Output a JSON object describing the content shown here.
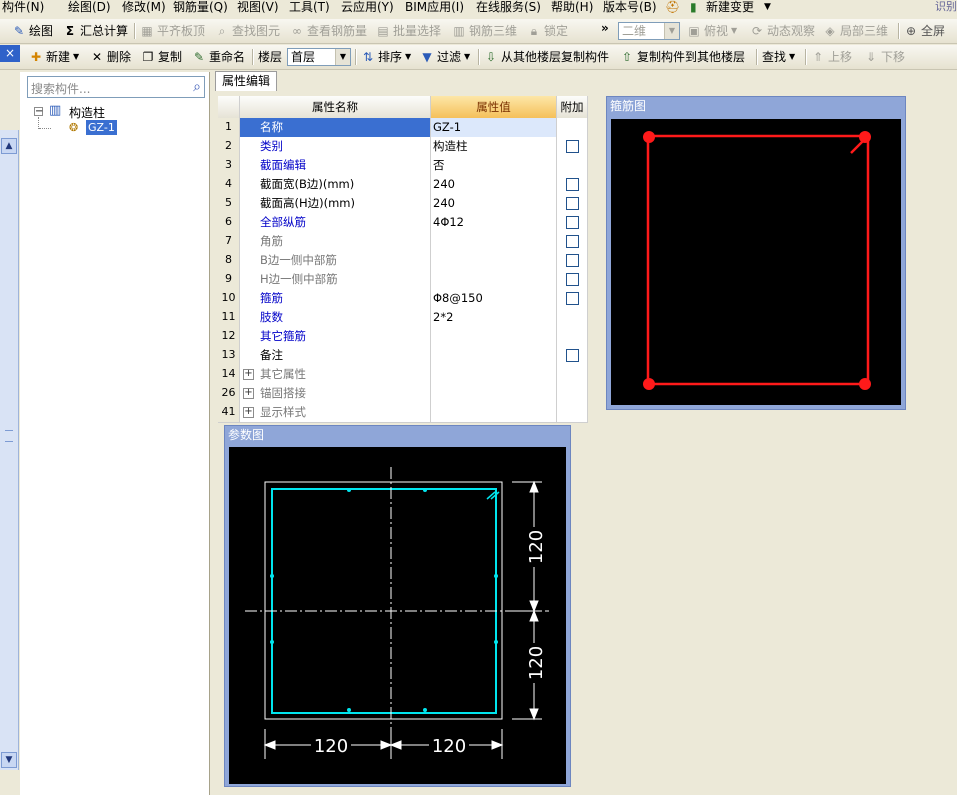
{
  "menu": [
    "构件(N)",
    "绘图(D)",
    "修改(M)",
    "钢筋量(Q)",
    "视图(V)",
    "工具(T)",
    "云应用(Y)",
    "BIM应用(I)",
    "在线服务(S)",
    "帮助(H)",
    "版本号(B)",
    "新建变更"
  ],
  "menu_overflow": "识别",
  "toolbar1": {
    "draw": "绘图",
    "sum": "汇总计算",
    "level": "平齐板顶",
    "find_elem": "查找图元",
    "view_rebar": "查看钢筋量",
    "batch_select": "批量选择",
    "rebar_3d": "钢筋三维",
    "lock": "锁定",
    "view_mode": "二维",
    "top_view": "俯视",
    "dynamic_view": "动态观察",
    "local_3d": "局部三维",
    "fullscreen": "全屏"
  },
  "toolbar2": {
    "new": "新建",
    "delete": "删除",
    "copy": "复制",
    "rename": "重命名",
    "floor_label": "楼层",
    "floor_value": "首层",
    "sort": "排序",
    "filter": "过滤",
    "copy_from": "从其他楼层复制构件",
    "copy_to": "复制构件到其他楼层",
    "find": "查找",
    "move_up": "上移",
    "move_down": "下移"
  },
  "left_panel": {
    "close_btn": "×",
    "search_placeholder": "搜索构件...",
    "tree_root": "构造柱",
    "tree_child": "GZ-1"
  },
  "tab_label": "属性编辑",
  "grid": {
    "headers": {
      "name": "属性名称",
      "value": "属性值",
      "extra": "附加"
    },
    "rows": [
      {
        "no": "1",
        "name": "名称",
        "value": "GZ-1",
        "style": "blue",
        "check": false,
        "sel": true
      },
      {
        "no": "2",
        "name": "类别",
        "value": "构造柱",
        "style": "blue",
        "check": true
      },
      {
        "no": "3",
        "name": "截面编辑",
        "value": "否",
        "style": "blue",
        "check": false
      },
      {
        "no": "4",
        "name": "截面宽(B边)(mm)",
        "value": "240",
        "style": "normal",
        "check": true
      },
      {
        "no": "5",
        "name": "截面高(H边)(mm)",
        "value": "240",
        "style": "normal",
        "check": true
      },
      {
        "no": "6",
        "name": "全部纵筋",
        "value": "4Φ12",
        "style": "blue",
        "check": true
      },
      {
        "no": "7",
        "name": "角筋",
        "value": "",
        "style": "gray",
        "check": true
      },
      {
        "no": "8",
        "name": "B边一侧中部筋",
        "value": "",
        "style": "gray",
        "check": true
      },
      {
        "no": "9",
        "name": "H边一侧中部筋",
        "value": "",
        "style": "gray",
        "check": true
      },
      {
        "no": "10",
        "name": "箍筋",
        "value": "Φ8@150",
        "style": "blue",
        "check": true
      },
      {
        "no": "11",
        "name": "肢数",
        "value": "2*2",
        "style": "blue",
        "check": false
      },
      {
        "no": "12",
        "name": "其它箍筋",
        "value": "",
        "style": "blue",
        "check": false
      },
      {
        "no": "13",
        "name": "备注",
        "value": "",
        "style": "normal",
        "check": true
      },
      {
        "no": "14",
        "name": "其它属性",
        "value": "",
        "style": "gray",
        "check": false,
        "expand": true
      },
      {
        "no": "26",
        "name": "锚固搭接",
        "value": "",
        "style": "gray",
        "check": false,
        "expand": true
      },
      {
        "no": "41",
        "name": "显示样式",
        "value": "",
        "style": "gray",
        "check": false,
        "expand": true
      }
    ]
  },
  "stirrup_panel": {
    "title": "箍筋图"
  },
  "param_panel": {
    "title": "参数图",
    "dim_top_right": "120",
    "dim_bottom_right": "120",
    "dim_bottom_left": "120",
    "dim_bottom_right_h": "120"
  },
  "colors": {
    "selection": "#3a6fd1",
    "stirrup": "#ff1a1a",
    "section": "#00e5ee",
    "dims": "#ffffff"
  }
}
